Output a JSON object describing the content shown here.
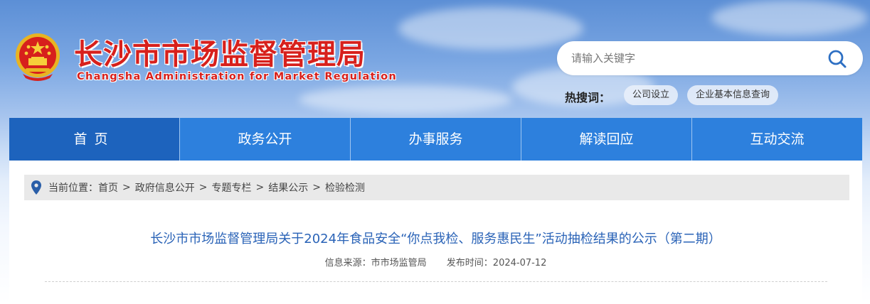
{
  "header": {
    "title_cn": "长沙市市场监督管理局",
    "title_en": "Changsha Administration for Market Regulation"
  },
  "search": {
    "placeholder": "请输入关键字",
    "value": ""
  },
  "hot_search": {
    "label": "热搜词：",
    "tags": [
      "公司设立",
      "企业基本信息查询"
    ]
  },
  "nav": {
    "items": [
      "首页",
      "政务公开",
      "办事服务",
      "解读回应",
      "互动交流"
    ]
  },
  "breadcrumb": {
    "prefix": "当前位置：",
    "items": [
      "首页",
      "政府信息公开",
      "专题专栏",
      "结果公示",
      "检验检测"
    ],
    "separator": ">"
  },
  "article": {
    "title": "长沙市市场监督管理局关于2024年食品安全“你点我检、服务惠民生”活动抽检结果的公示（第二期）",
    "source": "信息来源：市市场监管局",
    "published": "发布时间：2024-07-12"
  },
  "colors": {
    "brand_red": "#d7201c",
    "nav_blue": "#2d80dd",
    "nav_active": "#1d63bd",
    "title_blue": "#2a63b7"
  },
  "icons": {
    "emblem": "national-emblem-icon",
    "search": "search-icon",
    "location": "location-pin-icon"
  }
}
